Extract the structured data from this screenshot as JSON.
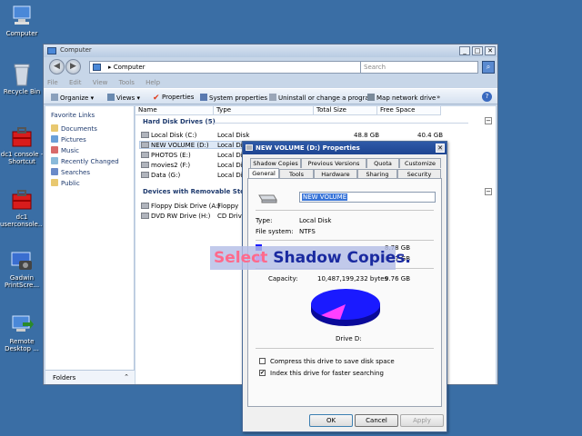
{
  "desktop": {
    "icons": [
      {
        "label": "Computer"
      },
      {
        "label": "Recycle Bin"
      },
      {
        "label": "dc1 console -\nShortcut"
      },
      {
        "label": "dc1\nuserconsole..."
      },
      {
        "label": "Gadwin\nPrintScre..."
      },
      {
        "label": "Remote\nDesktop ..."
      }
    ]
  },
  "explorer": {
    "title": "Computer",
    "address": "Computer",
    "search_placeholder": "Search",
    "menu": [
      "File",
      "Edit",
      "View",
      "Tools",
      "Help"
    ],
    "toolbar": {
      "organize": "Organize",
      "views": "Views",
      "properties": "Properties",
      "system_properties": "System properties",
      "uninstall": "Uninstall or change a program",
      "map_drive": "Map network drive",
      "more": "»"
    },
    "favorites_title": "Favorite Links",
    "favorites": [
      "Documents",
      "Pictures",
      "Music",
      "Recently Changed",
      "Searches",
      "Public"
    ],
    "folders_label": "Folders",
    "columns": [
      "Name",
      "Type",
      "Total Size",
      "Free Space"
    ],
    "groups": {
      "hdd": "Hard Disk Drives (5)",
      "removable": "Devices with Removable Stora"
    },
    "hdd_rows": [
      {
        "name": "Local Disk (C:)",
        "type": "Local Disk",
        "total": "48.8 GB",
        "free": "40.4 GB"
      },
      {
        "name": "NEW VOLUME (D:)",
        "type": "Local Di",
        "total": "",
        "free": ""
      },
      {
        "name": "PHOTOS (E:)",
        "type": "Local Di",
        "total": "",
        "free": ""
      },
      {
        "name": "movies2 (F:)",
        "type": "Local Di",
        "total": "",
        "free": ""
      },
      {
        "name": "Data (G:)",
        "type": "Local Di",
        "total": "",
        "free": ""
      }
    ],
    "removable_rows": [
      {
        "name": "Floppy Disk Drive (A:)",
        "type": "Floppy"
      },
      {
        "name": "DVD RW Drive (H:)",
        "type": "CD Driv"
      }
    ]
  },
  "dialog": {
    "title": "NEW VOLUME (D:) Properties",
    "close": "✕",
    "tabs_back": [
      "Shadow Copies",
      "Previous Versions",
      "Quota",
      "Customize"
    ],
    "tabs_front": [
      "General",
      "Tools",
      "Hardware",
      "Sharing",
      "Security"
    ],
    "volume_name": "NEW VOLUME",
    "type_label": "Type:",
    "type_value": "Local Disk",
    "fs_label": "File system:",
    "fs_value": "NTFS",
    "used_gb": "8.78 GB",
    "free_gb": "0.97 GB",
    "capacity_label": "Capacity:",
    "capacity_bytes": "10,487,199,232 bytes",
    "capacity_gb": "9.76 GB",
    "drive_label": "Drive D:",
    "used_fraction": 0.9,
    "compress_label": "Compress this drive to save disk space",
    "index_label": "Index this drive for faster searching",
    "compress_checked": false,
    "index_checked": true,
    "ok": "OK",
    "cancel": "Cancel",
    "apply": "Apply",
    "colors": {
      "used": "#1a1aff",
      "free": "#ff40ff"
    }
  },
  "caption": {
    "word1": "Select",
    "word2": "Shadow Copies."
  }
}
